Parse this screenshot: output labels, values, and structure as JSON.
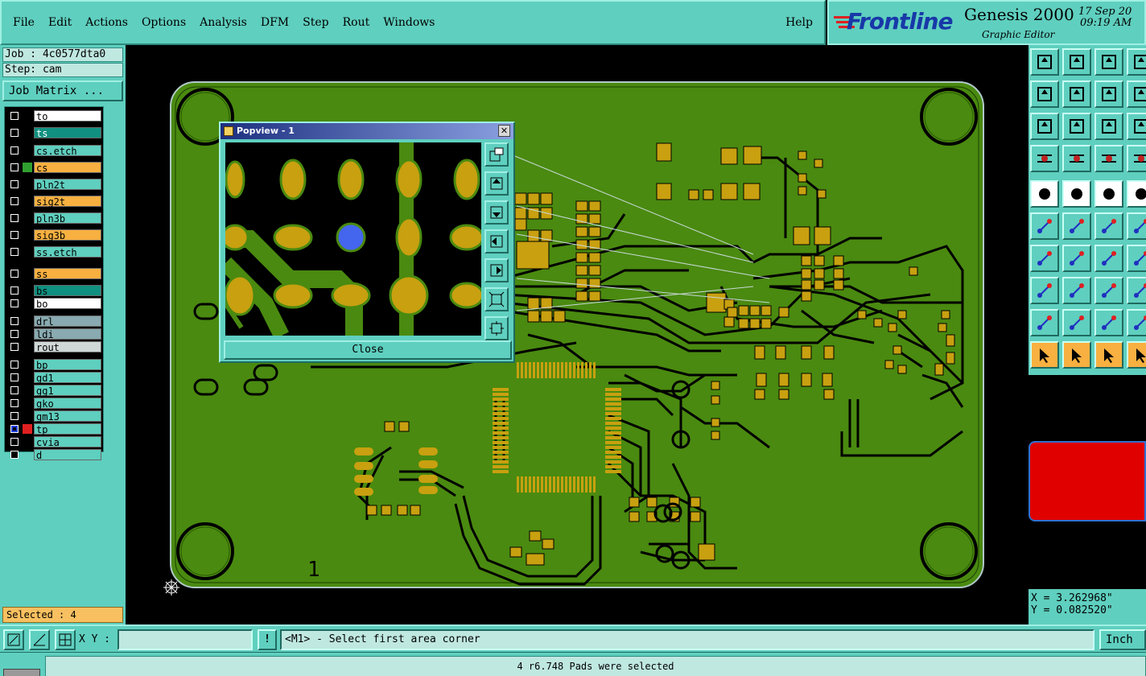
{
  "menubar": {
    "items": [
      "File",
      "Edit",
      "Actions",
      "Options",
      "Analysis",
      "DFM",
      "Step",
      "Rout",
      "Windows"
    ],
    "help": "Help"
  },
  "brand": {
    "logo": "Frontline",
    "product": "Genesis 2000",
    "subtitle": "Graphic Editor",
    "date": "17 Sep 20",
    "time": "09:19 AM"
  },
  "job": {
    "job_label": "Job : 4c0577dta0",
    "step_label": "Step: cam",
    "matrix_button": "Job Matrix ..."
  },
  "layers": [
    {
      "name": "to",
      "color": "#ffffff",
      "group": 0
    },
    {
      "name": "ts",
      "color": "#109080",
      "group": 0,
      "text_color": "#fff"
    },
    {
      "name": "cs.etch",
      "color": "#5fcfbf",
      "group": 1
    },
    {
      "name": "cs",
      "color": "#f8b040",
      "group": 1,
      "marker": "#30a030"
    },
    {
      "name": "pln2t",
      "color": "#5fcfbf",
      "group": 1
    },
    {
      "name": "sig2t",
      "color": "#f8b040",
      "group": 1
    },
    {
      "name": "pln3b",
      "color": "#5fcfbf",
      "group": 1
    },
    {
      "name": "sig3b",
      "color": "#f8b040",
      "group": 1
    },
    {
      "name": "ss.etch",
      "color": "#5fcfbf",
      "group": 1
    },
    {
      "name": "ss",
      "color": "#f8b040",
      "group": 2
    },
    {
      "name": "bs",
      "color": "#109080",
      "group": 2
    },
    {
      "name": "bo",
      "color": "#ffffff",
      "group": 2
    },
    {
      "name": "drl",
      "color": "#88aab0",
      "group": 3
    },
    {
      "name": "ldi",
      "color": "#88aab0",
      "group": 3
    },
    {
      "name": "rout",
      "color": "#d0d8d8",
      "group": 3
    },
    {
      "name": "bp",
      "color": "#5fcfbf",
      "group": 4
    },
    {
      "name": "gd1",
      "color": "#5fcfbf",
      "group": 4
    },
    {
      "name": "gg1",
      "color": "#5fcfbf",
      "group": 4
    },
    {
      "name": "gko",
      "color": "#5fcfbf",
      "group": 4
    },
    {
      "name": "gm13",
      "color": "#5fcfbf",
      "group": 4
    },
    {
      "name": "tp",
      "color": "#5fcfbf",
      "group": 4,
      "active": true
    },
    {
      "name": "cvia",
      "color": "#5fcfbf",
      "group": 4
    },
    {
      "name": "d",
      "color": "#5fcfbf",
      "group": 4
    }
  ],
  "selected_label": "Selected : 4",
  "popview": {
    "title": "Popview - 1",
    "close_label": "Close"
  },
  "board": {
    "silk_number": "1",
    "colors": {
      "board": "#4a8a10",
      "copper": "#c8a010",
      "selected_pad": "#4466ee",
      "outline": "#b0c8c8"
    }
  },
  "coords": {
    "x": "X = 3.262968\"",
    "y": "Y = 0.082520\""
  },
  "cmdbar": {
    "xy_label": "X Y :",
    "xy_value": "",
    "warn_glyph": "!",
    "prompt": "<M1> - Select first area corner",
    "units": "Inch"
  },
  "status": {
    "message": "4 r6.748 Pads were selected"
  }
}
